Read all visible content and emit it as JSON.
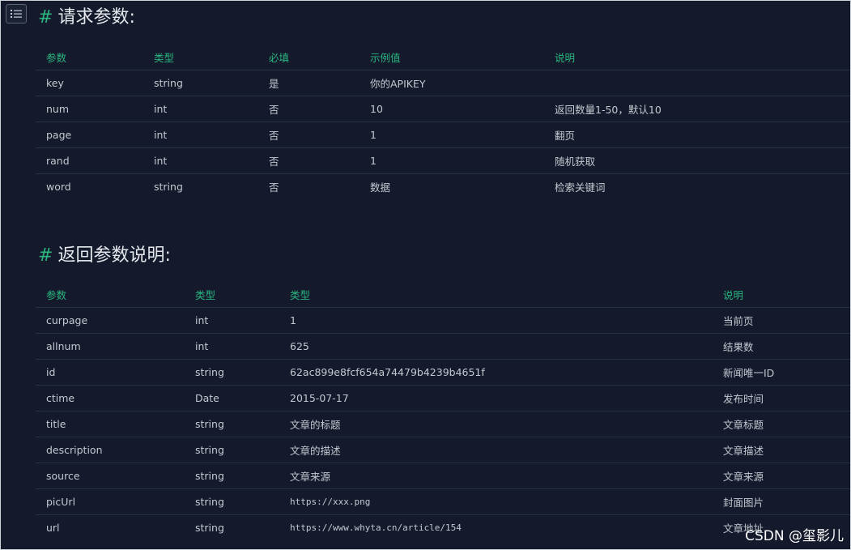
{
  "request": {
    "title": "请求参数:",
    "headers": [
      "参数",
      "类型",
      "必填",
      "示例值",
      "说明"
    ],
    "rows": [
      [
        "key",
        "string",
        "是",
        "你的APIKEY",
        ""
      ],
      [
        "num",
        "int",
        "否",
        "10",
        "返回数量1-50，默认10"
      ],
      [
        "page",
        "int",
        "否",
        "1",
        "翻页"
      ],
      [
        "rand",
        "int",
        "否",
        "1",
        "随机获取"
      ],
      [
        "word",
        "string",
        "否",
        "数据",
        "检索关键词"
      ]
    ]
  },
  "response": {
    "title": "返回参数说明:",
    "headers": [
      "参数",
      "类型",
      "类型",
      "说明"
    ],
    "rows": [
      [
        "curpage",
        "int",
        "1",
        "当前页"
      ],
      [
        "allnum",
        "int",
        "625",
        "结果数"
      ],
      [
        "id",
        "string",
        "62ac899e8fcf654a74479b4239b4651f",
        "新闻唯一ID"
      ],
      [
        "ctime",
        "Date",
        "2015-07-17",
        "发布时间"
      ],
      [
        "title",
        "string",
        "文章的标题",
        "文章标题"
      ],
      [
        "description",
        "string",
        "文章的描述",
        "文章描述"
      ],
      [
        "source",
        "string",
        "文章来源",
        "文章来源"
      ],
      [
        "picUrl",
        "string",
        "https://xxx.png",
        "封面图片"
      ],
      [
        "url",
        "string",
        "https://www.whyta.cn/article/154",
        "文章地址"
      ]
    ]
  },
  "code_cells": [
    "https://xxx.png",
    "https://www.whyta.cn/article/154"
  ],
  "heading_mark": "#",
  "watermark": "CSDN @玺影儿",
  "icons": {
    "toc": "list-toc-icon"
  },
  "colors": {
    "background": "#141a2b",
    "accent": "#2bb57f",
    "text": "#c3c8d0"
  }
}
